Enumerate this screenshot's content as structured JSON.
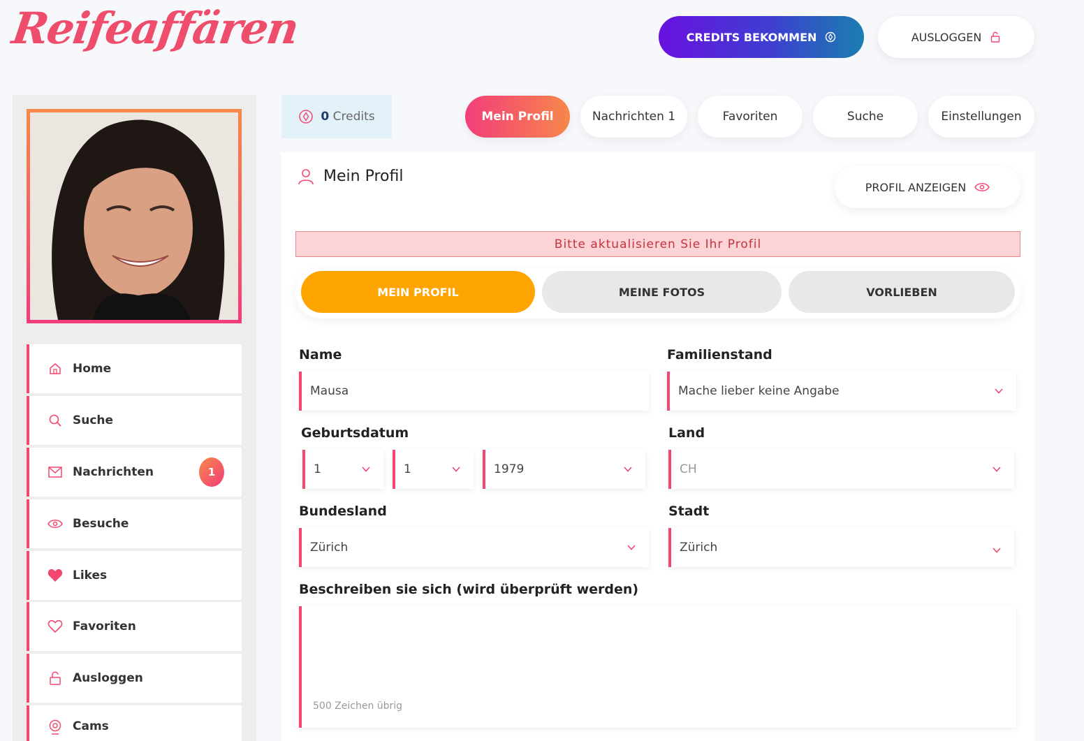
{
  "brand": {
    "logo_text": "Reifeaffären"
  },
  "header": {
    "credits_button": "CREDITS BEKOMMEN",
    "logout_button": "AUSLOGGEN"
  },
  "sidebar": {
    "items": [
      {
        "label": "Home",
        "icon": "home-icon"
      },
      {
        "label": "Suche",
        "icon": "search-icon"
      },
      {
        "label": "Nachrichten",
        "icon": "mail-icon",
        "badge": "1"
      },
      {
        "label": "Besuche",
        "icon": "eye-icon"
      },
      {
        "label": "Likes",
        "icon": "heart-filled-icon"
      },
      {
        "label": "Favoriten",
        "icon": "heart-outline-icon"
      },
      {
        "label": "Ausloggen",
        "icon": "unlock-icon"
      },
      {
        "label": "Cams",
        "icon": "webcam-icon"
      }
    ]
  },
  "credits": {
    "count": "0",
    "label": "Credits"
  },
  "tabs": [
    {
      "label": "Mein Profil",
      "active": true
    },
    {
      "label": "Nachrichten 1",
      "active": false
    },
    {
      "label": "Favoriten",
      "active": false
    },
    {
      "label": "Suche",
      "active": false
    },
    {
      "label": "Einstellungen",
      "active": false
    }
  ],
  "card": {
    "title": "Mein Profil",
    "view_button": "PROFIL ANZEIGEN",
    "alert": "Bitte aktualisieren Sie Ihr Profil",
    "subtabs": [
      {
        "label": "MEIN PROFIL",
        "active": true
      },
      {
        "label": "MEINE FOTOS",
        "active": false
      },
      {
        "label": "VORLIEBEN",
        "active": false
      }
    ]
  },
  "form": {
    "name_label": "Name",
    "name_value": "Mausa",
    "marital_label": "Familienstand",
    "marital_value": "Mache lieber keine Angabe",
    "birth_label": "Geburtsdatum",
    "birth_day": "1",
    "birth_month": "1",
    "birth_year": "1979",
    "country_label": "Land",
    "country_value": "CH",
    "state_label": "Bundesland",
    "state_value": "Zürich",
    "city_label": "Stadt",
    "city_value": "Zürich",
    "description_label": "Beschreiben sie sich (wird überprüft werden)",
    "description_counter": "500 Zeichen übrig"
  },
  "colors": {
    "accent_pink": "#f33d7a",
    "accent_orange": "#f7874a",
    "subtab_active": "#ffa502",
    "credits_gradient_start": "#6a11e0",
    "credits_gradient_end": "#1a7fb0"
  }
}
